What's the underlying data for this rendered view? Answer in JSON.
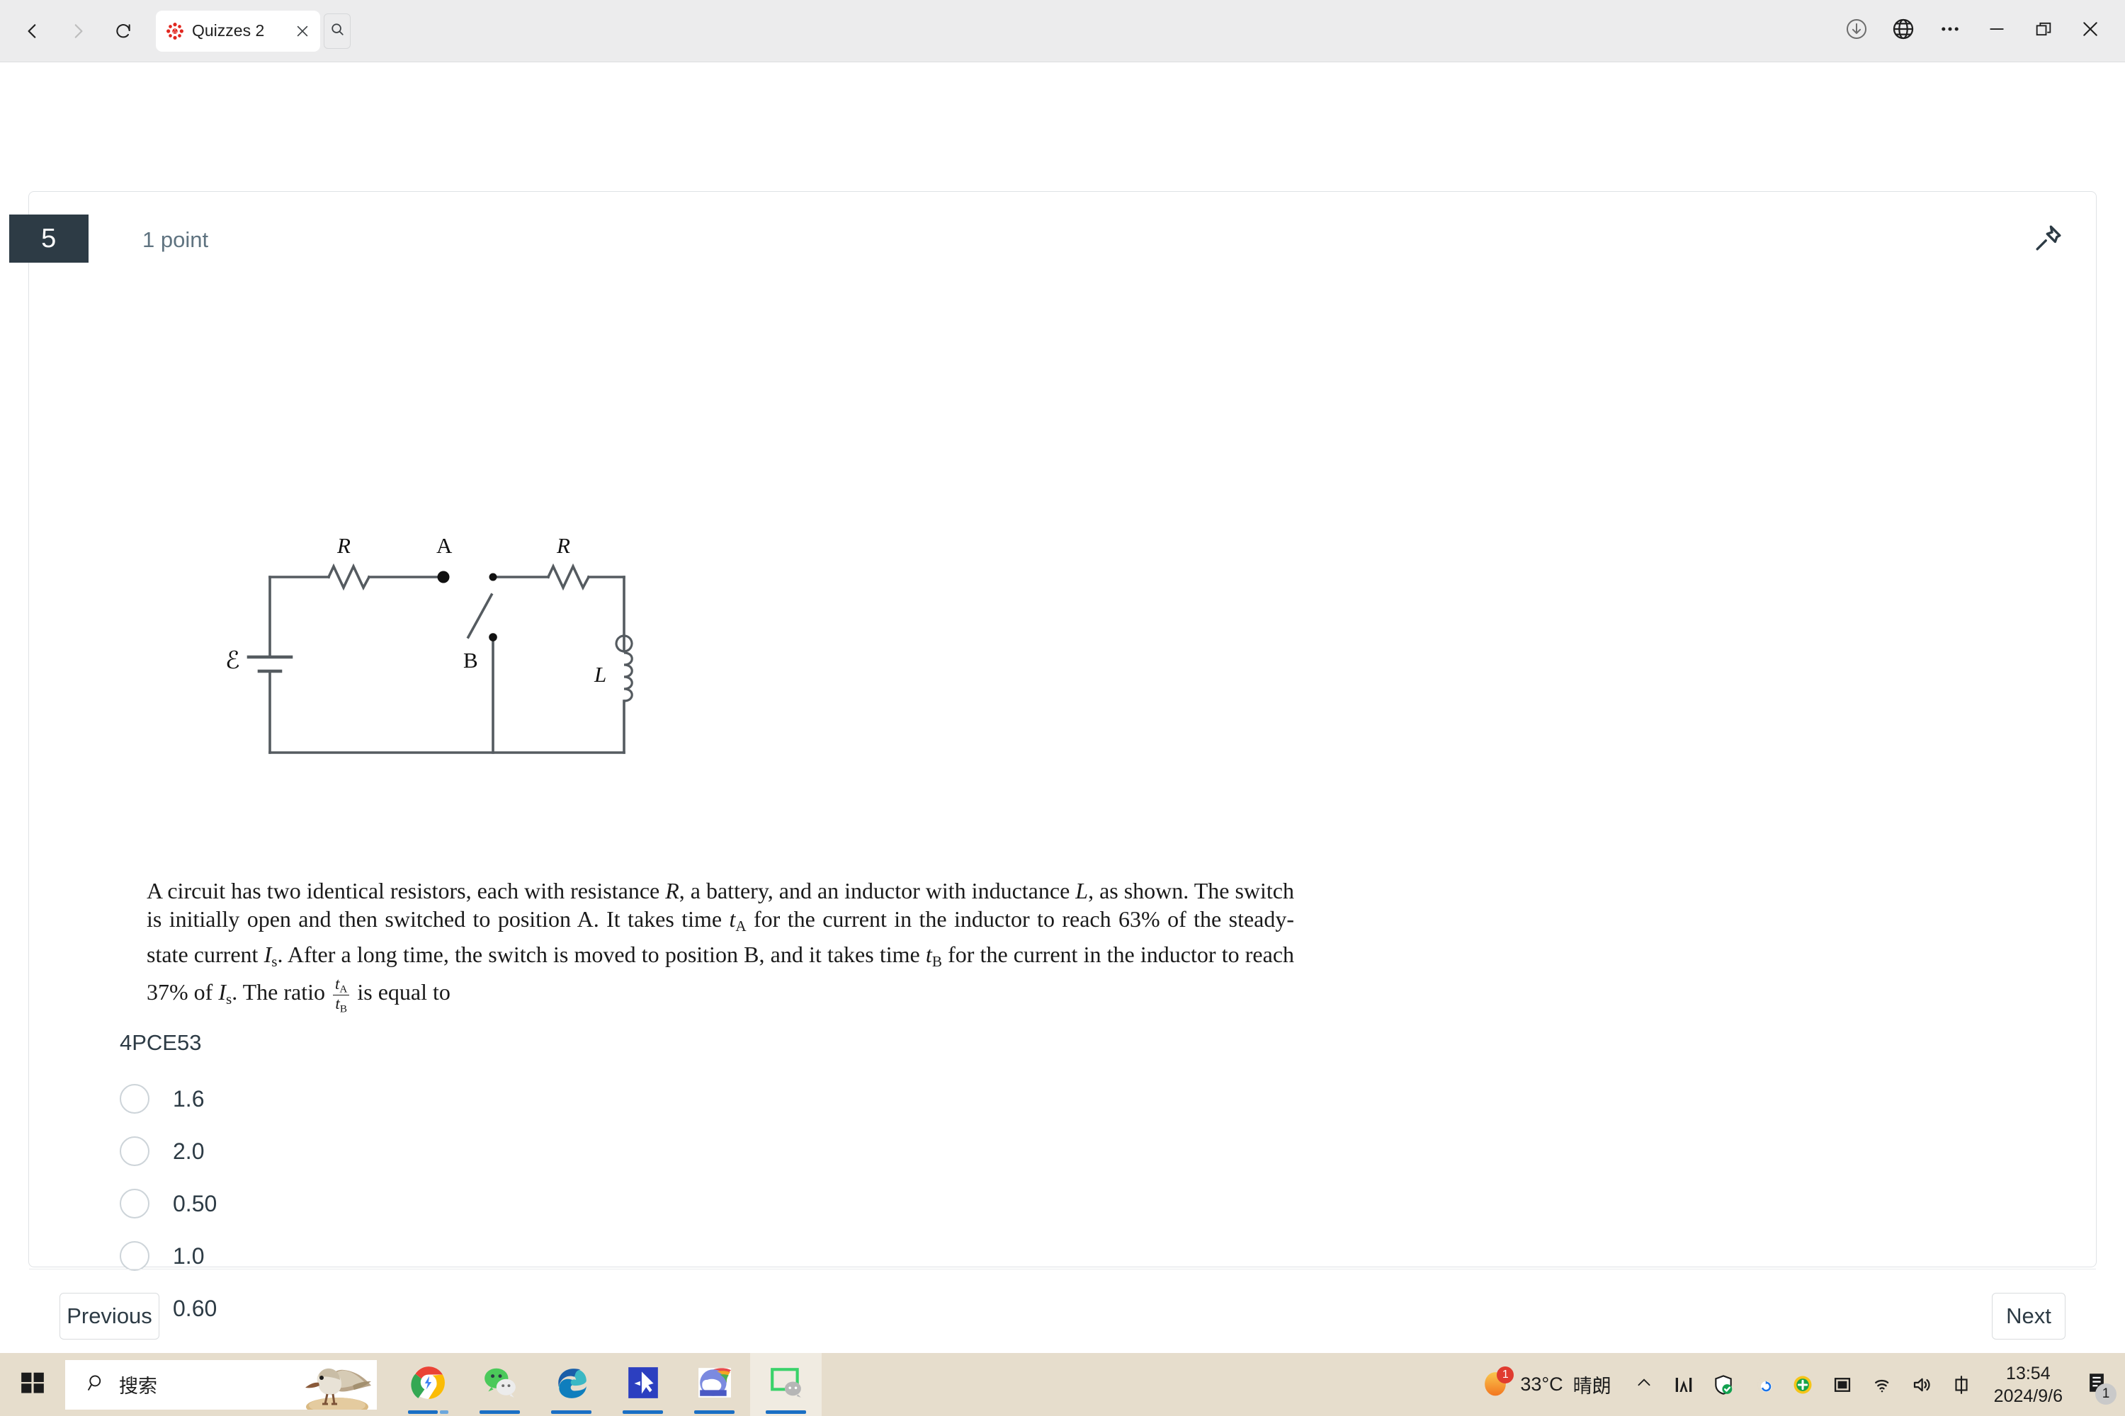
{
  "browser": {
    "back_icon": "back-arrow-icon",
    "forward_icon": "forward-arrow-icon",
    "reload_icon": "reload-icon",
    "tab": {
      "title": "Quizzes 2",
      "favicon": "canvas-lms-logo",
      "close_icon": "close-icon"
    },
    "tab_search_icon": "search-icon",
    "window_controls": {
      "downloads_icon": "download-icon",
      "translate_icon": "globe-icon",
      "more_icon": "more-options-icon",
      "minimize_icon": "minimize-icon",
      "maximize_icon": "restore-icon",
      "close_icon": "close-icon"
    }
  },
  "quiz": {
    "question_number": "5",
    "points": "1 point",
    "pin_icon": "pushpin-icon",
    "question_code": "4PCE53",
    "text": {
      "line1_a": "A circuit has two identical resistors, each with resistance ",
      "var_R": "R",
      "line1_b": ", a battery, and an inductor with inductance ",
      "var_L": "L",
      "line1_c": ", as shown. The switch is initially open and then switched to position ",
      "var_A": "A",
      "line2_a": ". It takes time ",
      "var_tA": "t",
      "sub_A": "A",
      "line2_b": " for the current in the inductor to reach ",
      "pct63": "63%",
      "line2_c": " of the steady-state current ",
      "var_I": "I",
      "sub_s": "s",
      "line3_a": ". After a long time, the switch is moved to position ",
      "var_B": "B",
      "line3_b": ", and it takes time ",
      "var_tB": "t",
      "sub_B": "B",
      "line3_c": " for the current in the inductor to reach ",
      "pct37": "37%",
      "line3_d": " of ",
      "line4_a": ". The ratio ",
      "frac_num": "t",
      "frac_num_sub": "A",
      "frac_den": "t",
      "frac_den_sub": "B",
      "line4_b": " is equal to"
    },
    "answers": [
      {
        "label": "1.6",
        "selected": false
      },
      {
        "label": "2.0",
        "selected": false
      },
      {
        "label": "0.50",
        "selected": false
      },
      {
        "label": "1.0",
        "selected": false
      },
      {
        "label": "0.60",
        "selected": false
      }
    ],
    "previous_label": "Previous",
    "next_label": "Next",
    "circuit": {
      "label_battery": "ℰ",
      "label_resistor_left": "R",
      "label_resistor_right": "R",
      "label_node_a": "A",
      "label_node_b": "B",
      "label_inductor": "L"
    },
    "colors": {
      "number_badge_bg": "#2d3b45",
      "text": "#2d3b45",
      "points_text": "#5f7380",
      "border": "#dfe2e5",
      "radio_border": "#cdd4d9"
    }
  },
  "taskbar": {
    "start_icon": "windows-start-icon",
    "search": {
      "placeholder": "搜索",
      "icon": "search-icon"
    },
    "bing_image": "sandpiper-bird-image",
    "apps": [
      {
        "name": "chrome",
        "active": false
      },
      {
        "name": "wechat",
        "active": false
      },
      {
        "name": "edge",
        "active": false
      },
      {
        "name": "cursor-app",
        "active": false
      },
      {
        "name": "weather-app",
        "active": false
      },
      {
        "name": "wechat-desktop",
        "active": true
      }
    ],
    "weather": {
      "temperature": "33°C",
      "condition": "晴朗",
      "badge": "1",
      "icon": "sun-icon"
    },
    "tray_icons": [
      "chevron-up-icon",
      "monitor-meter-icon",
      "security-shield-icon",
      "sync-icon",
      "green-plus-icon",
      "display-icon",
      "wifi-icon",
      "volume-icon",
      "ime-chinese-icon"
    ],
    "clock": {
      "time": "13:54",
      "date": "2024/9/6"
    },
    "notification": {
      "icon": "notification-icon",
      "count": "1"
    }
  }
}
